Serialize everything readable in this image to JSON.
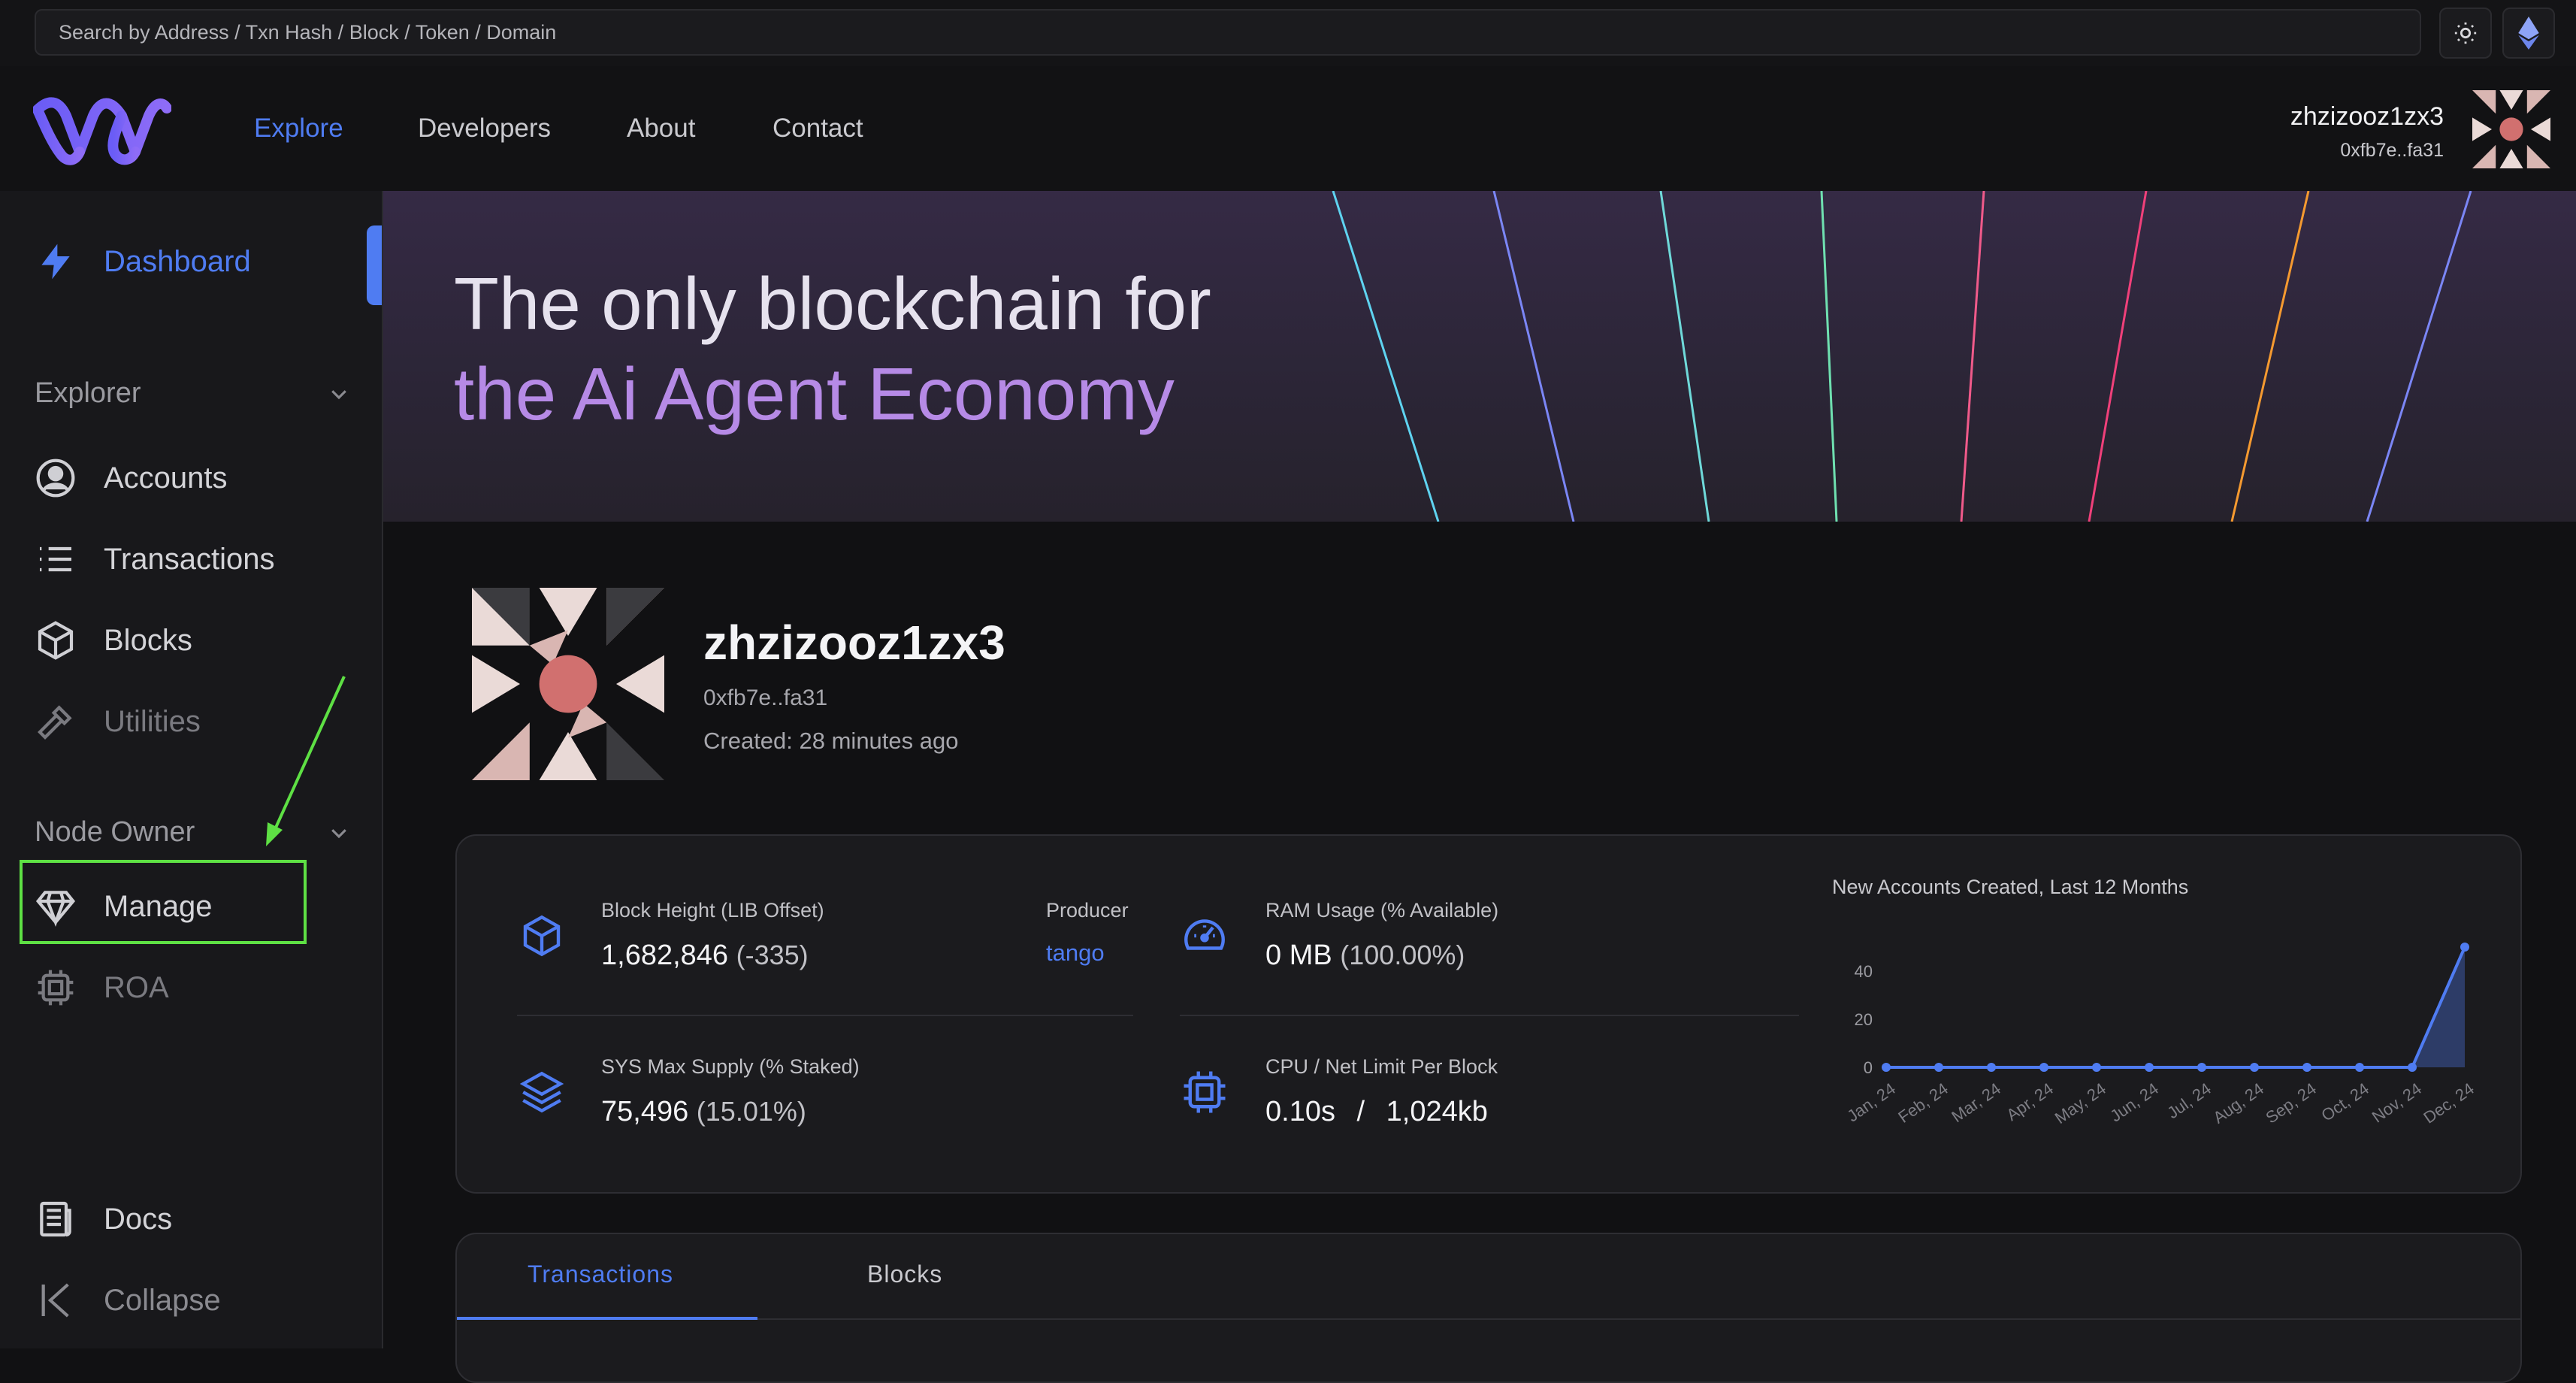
{
  "search": {
    "placeholder": "Search by Address / Txn Hash / Block / Token / Domain"
  },
  "nav": {
    "items": [
      {
        "label": "Explore",
        "active": true
      },
      {
        "label": "Developers"
      },
      {
        "label": "About"
      },
      {
        "label": "Contact"
      }
    ]
  },
  "user": {
    "name": "zhzizooz1zx3",
    "address": "0xfb7e..fa31"
  },
  "sidebar": {
    "dashboard": "Dashboard",
    "explorer_section": "Explorer",
    "explorer_items": [
      "Accounts",
      "Transactions",
      "Blocks",
      "Utilities"
    ],
    "node_owner_section": "Node Owner",
    "node_owner_items": [
      "Manage",
      "ROA"
    ],
    "docs": "Docs",
    "collapse": "Collapse"
  },
  "hero": {
    "line1": "The only blockchain for",
    "line2": "the Ai Agent Economy"
  },
  "profile": {
    "name": "zhzizooz1zx3",
    "address": "0xfb7e..fa31",
    "created": "Created: 28 minutes ago"
  },
  "stats": {
    "block_height_label": "Block Height (LIB Offset)",
    "block_height_value": "1,682,846",
    "block_height_offset": "(-335)",
    "producer_label": "Producer",
    "producer_value": "tango",
    "ram_label": "RAM Usage (% Available)",
    "ram_value": "0 MB",
    "ram_available": "(100.00%)",
    "supply_label": "SYS Max Supply (% Staked)",
    "supply_value": "75,496",
    "supply_staked": "(15.01%)",
    "cpu_label": "CPU / Net Limit Per Block",
    "cpu_value": "0.10s",
    "cpu_sep": "/",
    "net_value": "1,024kb"
  },
  "tabs": [
    "Transactions",
    "Blocks"
  ],
  "colors": {
    "accent": "#4f7cf2",
    "highlight_box": "#5ee044",
    "annotation_arrow": "#5ee044"
  },
  "chart_data": {
    "type": "area",
    "title": "New Accounts Created, Last 12 Months",
    "categories": [
      "Jan, 24",
      "Feb, 24",
      "Mar, 24",
      "Apr, 24",
      "May, 24",
      "Jun, 24",
      "Jul, 24",
      "Aug, 24",
      "Sep, 24",
      "Oct, 24",
      "Nov, 24",
      "Dec, 24"
    ],
    "values": [
      0,
      0,
      0,
      0,
      0,
      0,
      0,
      0,
      0,
      0,
      0,
      50
    ],
    "yticks": [
      0,
      20,
      40
    ],
    "ylim": [
      0,
      50
    ],
    "grid": false
  }
}
